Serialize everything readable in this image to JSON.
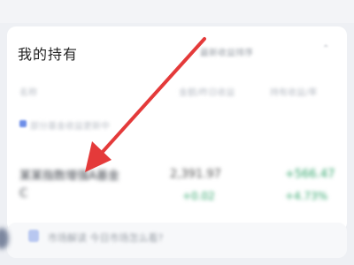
{
  "section": {
    "title": "我的持有",
    "sort_label": "最新收益排序",
    "chevron": "⌃"
  },
  "columns": {
    "name": "名称",
    "amount": "金额/昨日收益",
    "hold": "持有收益/率"
  },
  "notice": "部分基金收益更新中",
  "holding": {
    "name": "某某指数增强A基金C",
    "amount": "2,391.97",
    "daily_change": "+0.02",
    "hold_change": "+566.47",
    "hold_rate": "+4.73%"
  },
  "bottom_banner": "市场解读 今日市场怎么看?",
  "annotation": {
    "arrow_color": "#e43a3a"
  }
}
